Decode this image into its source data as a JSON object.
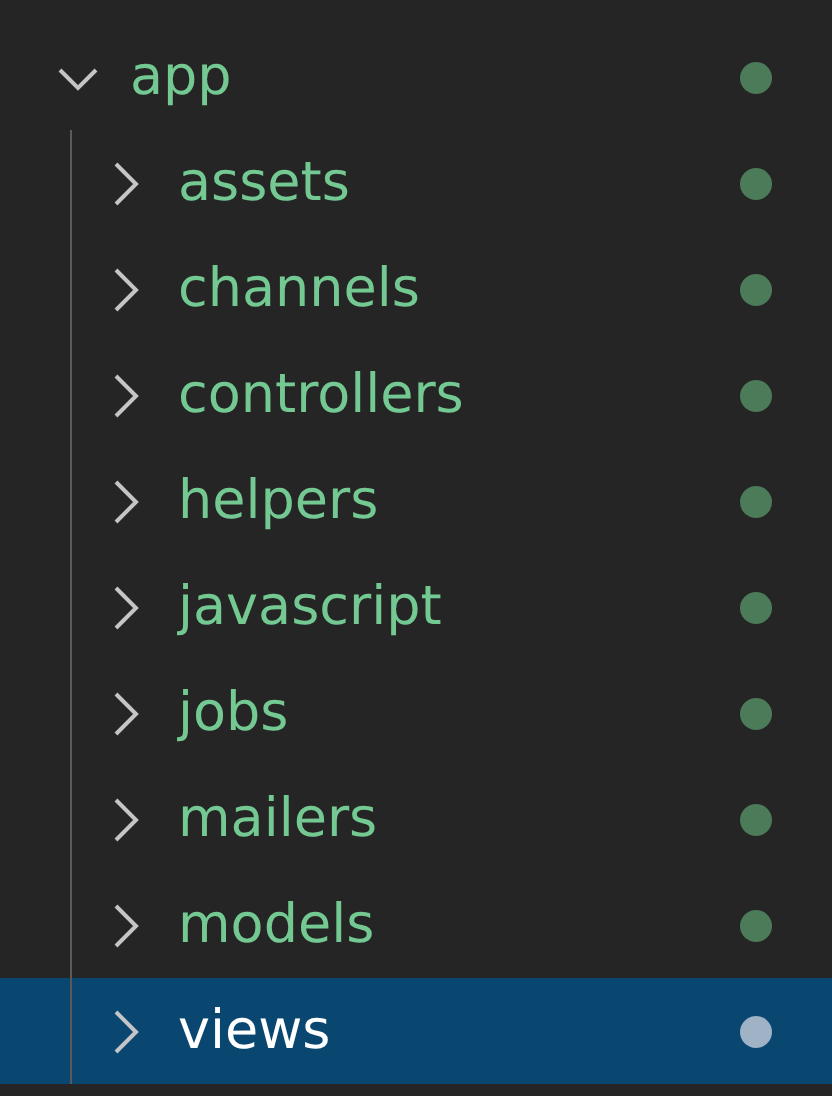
{
  "tree": [
    {
      "label": "app",
      "expanded": true,
      "selected": false,
      "children": [
        {
          "label": "assets",
          "expanded": false,
          "selected": false
        },
        {
          "label": "channels",
          "expanded": false,
          "selected": false
        },
        {
          "label": "controllers",
          "expanded": false,
          "selected": false
        },
        {
          "label": "helpers",
          "expanded": false,
          "selected": false
        },
        {
          "label": "javascript",
          "expanded": false,
          "selected": false
        },
        {
          "label": "jobs",
          "expanded": false,
          "selected": false
        },
        {
          "label": "mailers",
          "expanded": false,
          "selected": false
        },
        {
          "label": "models",
          "expanded": false,
          "selected": false
        },
        {
          "label": "views",
          "expanded": false,
          "selected": true
        }
      ]
    }
  ]
}
